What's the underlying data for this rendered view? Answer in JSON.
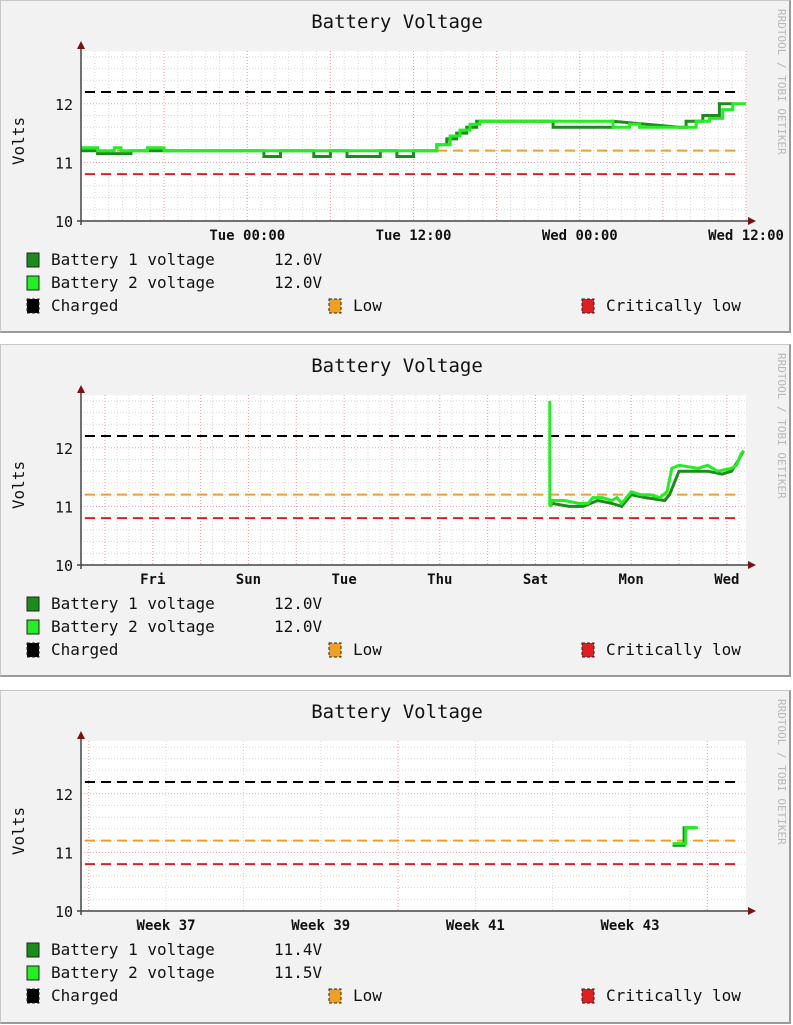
{
  "watermark": "RRDTOOL / TOBI OETIKER",
  "colors": {
    "battery1": "#1b8c1b",
    "battery2": "#22ee22",
    "charged": "#000000",
    "low": "#f0a020",
    "critical": "#e02020",
    "grid_minor": "#d8d8d8",
    "grid_major": "#f0a0a0",
    "axis": "#7a1010"
  },
  "chart_data": [
    {
      "type": "line",
      "title": "Battery Voltage",
      "ylabel": "Volts",
      "ylim": [
        10,
        12.9
      ],
      "yticks": [
        10,
        11,
        12
      ],
      "grid": true,
      "xrange": [
        0,
        1.85
      ],
      "xunit": "days since Mon 12:00",
      "xticks": [
        {
          "label": "Tue 00:00",
          "x": 0.5
        },
        {
          "label": "Tue 12:00",
          "x": 1.0
        },
        {
          "label": "Wed 00:00",
          "x": 1.5
        },
        {
          "label": "Wed 12:00",
          "x": 2.0
        }
      ],
      "thresholds": [
        {
          "name": "Charged",
          "value": 12.2,
          "color": "#000000"
        },
        {
          "name": "Low",
          "value": 11.2,
          "color": "#f0a020"
        },
        {
          "name": "Critically low",
          "value": 10.8,
          "color": "#e02020"
        }
      ],
      "series": [
        {
          "name": "Battery 1 voltage",
          "current": "12.0V",
          "color": "#1b8c1b",
          "points": [
            [
              0,
              11.2
            ],
            [
              0.05,
              11.2
            ],
            [
              0.05,
              11.15
            ],
            [
              0.15,
              11.15
            ],
            [
              0.15,
              11.2
            ],
            [
              0.55,
              11.2
            ],
            [
              0.55,
              11.1
            ],
            [
              0.6,
              11.1
            ],
            [
              0.6,
              11.2
            ],
            [
              0.7,
              11.2
            ],
            [
              0.7,
              11.1
            ],
            [
              0.75,
              11.1
            ],
            [
              0.75,
              11.2
            ],
            [
              0.8,
              11.2
            ],
            [
              0.8,
              11.1
            ],
            [
              0.9,
              11.1
            ],
            [
              0.9,
              11.2
            ],
            [
              0.95,
              11.2
            ],
            [
              0.95,
              11.1
            ],
            [
              1.0,
              11.1
            ],
            [
              1.0,
              11.2
            ],
            [
              1.07,
              11.2
            ],
            [
              1.07,
              11.3
            ],
            [
              1.1,
              11.3
            ],
            [
              1.1,
              11.4
            ],
            [
              1.13,
              11.4
            ],
            [
              1.13,
              11.5
            ],
            [
              1.16,
              11.5
            ],
            [
              1.16,
              11.6
            ],
            [
              1.19,
              11.6
            ],
            [
              1.19,
              11.7
            ],
            [
              1.42,
              11.7
            ],
            [
              1.42,
              11.6
            ],
            [
              1.6,
              11.6
            ],
            [
              1.6,
              11.7
            ],
            [
              1.8,
              11.6
            ],
            [
              1.82,
              11.6
            ],
            [
              1.82,
              11.7
            ],
            [
              1.87,
              11.7
            ],
            [
              1.87,
              11.8
            ],
            [
              1.92,
              11.8
            ],
            [
              1.92,
              12.0
            ],
            [
              1.96,
              12.0
            ]
          ]
        },
        {
          "name": "Battery 2 voltage",
          "current": "12.0V",
          "color": "#22ee22",
          "points": [
            [
              0,
              11.25
            ],
            [
              0.05,
              11.25
            ],
            [
              0.05,
              11.2
            ],
            [
              0.1,
              11.2
            ],
            [
              0.1,
              11.25
            ],
            [
              0.12,
              11.25
            ],
            [
              0.12,
              11.2
            ],
            [
              0.2,
              11.2
            ],
            [
              0.2,
              11.25
            ],
            [
              0.25,
              11.25
            ],
            [
              0.25,
              11.2
            ],
            [
              1.07,
              11.2
            ],
            [
              1.07,
              11.3
            ],
            [
              1.11,
              11.3
            ],
            [
              1.11,
              11.45
            ],
            [
              1.14,
              11.45
            ],
            [
              1.14,
              11.55
            ],
            [
              1.17,
              11.55
            ],
            [
              1.17,
              11.65
            ],
            [
              1.2,
              11.65
            ],
            [
              1.2,
              11.7
            ],
            [
              1.6,
              11.7
            ],
            [
              1.6,
              11.6
            ],
            [
              1.65,
              11.6
            ],
            [
              1.65,
              11.65
            ],
            [
              1.68,
              11.65
            ],
            [
              1.68,
              11.6
            ],
            [
              1.85,
              11.6
            ],
            [
              1.85,
              11.7
            ],
            [
              1.89,
              11.7
            ],
            [
              1.89,
              11.75
            ],
            [
              1.93,
              11.75
            ],
            [
              1.93,
              11.9
            ],
            [
              1.96,
              11.9
            ],
            [
              1.96,
              12.0
            ],
            [
              2.0,
              12.0
            ]
          ]
        }
      ]
    },
    {
      "type": "line",
      "title": "Battery Voltage",
      "ylabel": "Volts",
      "ylim": [
        10,
        12.9
      ],
      "yticks": [
        10,
        11,
        12
      ],
      "grid": true,
      "xrange": [
        0,
        7
      ],
      "xunit": "days since Wed",
      "xticks": [
        {
          "label": "Fri",
          "x": 2.0
        },
        {
          "label": "Sun",
          "x": 4.0
        },
        {
          "label": "Tue",
          "x": 6.0
        },
        {
          "label": "Thu",
          "x": 8.0
        },
        {
          "label": "Sat",
          "x": 10.0
        },
        {
          "label": "Mon",
          "x": 12.0
        },
        {
          "label": "Wed",
          "x": 14.0
        }
      ],
      "thresholds": [
        {
          "name": "Charged",
          "value": 12.2,
          "color": "#000000"
        },
        {
          "name": "Low",
          "value": 11.2,
          "color": "#f0a020"
        },
        {
          "name": "Critically low",
          "value": 10.8,
          "color": "#e02020"
        }
      ],
      "series": [
        {
          "name": "Battery 1 voltage",
          "current": "12.0V",
          "color": "#1b8c1b",
          "points": [
            [
              9.9,
              11.0
            ],
            [
              9.95,
              11.05
            ],
            [
              10.3,
              11.0
            ],
            [
              10.6,
              11.0
            ],
            [
              10.9,
              11.1
            ],
            [
              11.2,
              11.05
            ],
            [
              11.4,
              11.0
            ],
            [
              11.6,
              11.2
            ],
            [
              11.9,
              11.15
            ],
            [
              12.3,
              11.1
            ],
            [
              12.4,
              11.2
            ],
            [
              12.6,
              11.6
            ],
            [
              13.0,
              11.6
            ],
            [
              13.2,
              11.6
            ],
            [
              13.5,
              11.55
            ],
            [
              13.7,
              11.6
            ],
            [
              13.85,
              11.8
            ],
            [
              13.95,
              11.95
            ]
          ]
        },
        {
          "name": "Battery 2 voltage",
          "current": "12.0V",
          "color": "#22ee22",
          "points": [
            [
              9.9,
              12.8
            ],
            [
              9.9,
              11.0
            ],
            [
              9.95,
              11.1
            ],
            [
              10.2,
              11.1
            ],
            [
              10.5,
              11.05
            ],
            [
              10.7,
              11.05
            ],
            [
              10.8,
              11.15
            ],
            [
              11.0,
              11.15
            ],
            [
              11.2,
              11.1
            ],
            [
              11.3,
              11.15
            ],
            [
              11.4,
              11.05
            ],
            [
              11.5,
              11.15
            ],
            [
              11.6,
              11.25
            ],
            [
              11.8,
              11.2
            ],
            [
              12.0,
              11.2
            ],
            [
              12.2,
              11.15
            ],
            [
              12.35,
              11.25
            ],
            [
              12.45,
              11.65
            ],
            [
              12.6,
              11.7
            ],
            [
              13.0,
              11.65
            ],
            [
              13.2,
              11.7
            ],
            [
              13.4,
              11.6
            ],
            [
              13.7,
              11.65
            ],
            [
              13.8,
              11.7
            ],
            [
              13.9,
              11.9
            ],
            [
              13.95,
              11.95
            ]
          ]
        }
      ]
    },
    {
      "type": "line",
      "title": "Battery Voltage",
      "ylabel": "Volts",
      "ylim": [
        10,
        12.9
      ],
      "yticks": [
        10,
        11,
        12
      ],
      "grid": true,
      "xrange": [
        35.5,
        44.5
      ],
      "xunit": "week number",
      "xticks": [
        {
          "label": "Week 37",
          "x": 37
        },
        {
          "label": "Week 39",
          "x": 39
        },
        {
          "label": "Week 41",
          "x": 41
        },
        {
          "label": "Week 43",
          "x": 43
        }
      ],
      "thresholds": [
        {
          "name": "Charged",
          "value": 12.2,
          "color": "#000000"
        },
        {
          "name": "Low",
          "value": 11.2,
          "color": "#f0a020"
        },
        {
          "name": "Critically low",
          "value": 10.8,
          "color": "#e02020"
        }
      ],
      "series": [
        {
          "name": "Battery 1 voltage",
          "current": "11.4V",
          "color": "#1b8c1b",
          "points": [
            [
              43.55,
              11.12
            ],
            [
              43.7,
              11.12
            ],
            [
              43.7,
              11.42
            ],
            [
              43.85,
              11.42
            ]
          ]
        },
        {
          "name": "Battery 2 voltage",
          "current": "11.5V",
          "color": "#22ee22",
          "points": [
            [
              43.55,
              11.15
            ],
            [
              43.72,
              11.15
            ],
            [
              43.72,
              11.42
            ],
            [
              43.88,
              11.42
            ]
          ]
        }
      ]
    }
  ]
}
